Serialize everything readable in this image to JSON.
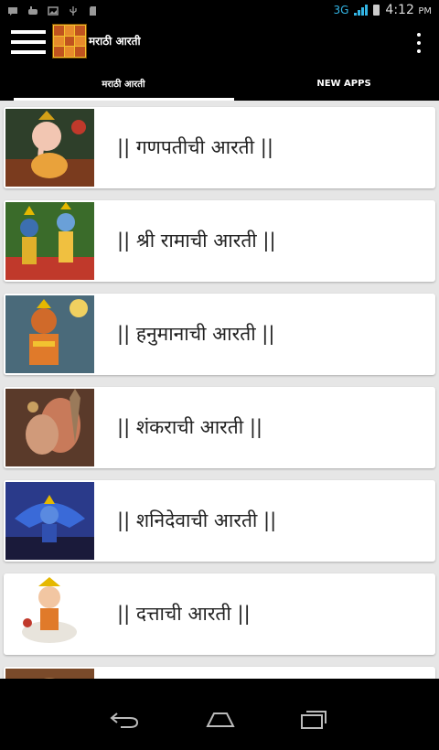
{
  "status_bar": {
    "network": "3G",
    "time": "4:12",
    "ampm": "PM"
  },
  "app_bar": {
    "title": "मराठी आरती"
  },
  "tabs": [
    {
      "label": "मराठी आरती",
      "active": true
    },
    {
      "label": "NEW APPS",
      "active": false
    }
  ],
  "aartis": [
    {
      "label": "|| गणपतीची आरती ||",
      "image": "ganpati-image"
    },
    {
      "label": "|| श्री रामाची आरती  ||",
      "image": "ram-image"
    },
    {
      "label": "|| हनुमानाची  आरती ||",
      "image": "hanuman-image"
    },
    {
      "label": "|| शंकराची आरती ||",
      "image": "shankar-image"
    },
    {
      "label": "|| शनिदेवाची आरती ||",
      "image": "shanidev-image"
    },
    {
      "label": "|| दत्ताची आरती ||",
      "image": "datta-image"
    }
  ],
  "colors": {
    "bar": "#000000",
    "list_bg": "#e6e6e6",
    "card": "#ffffff",
    "accent_signal": "#33b5e5"
  }
}
